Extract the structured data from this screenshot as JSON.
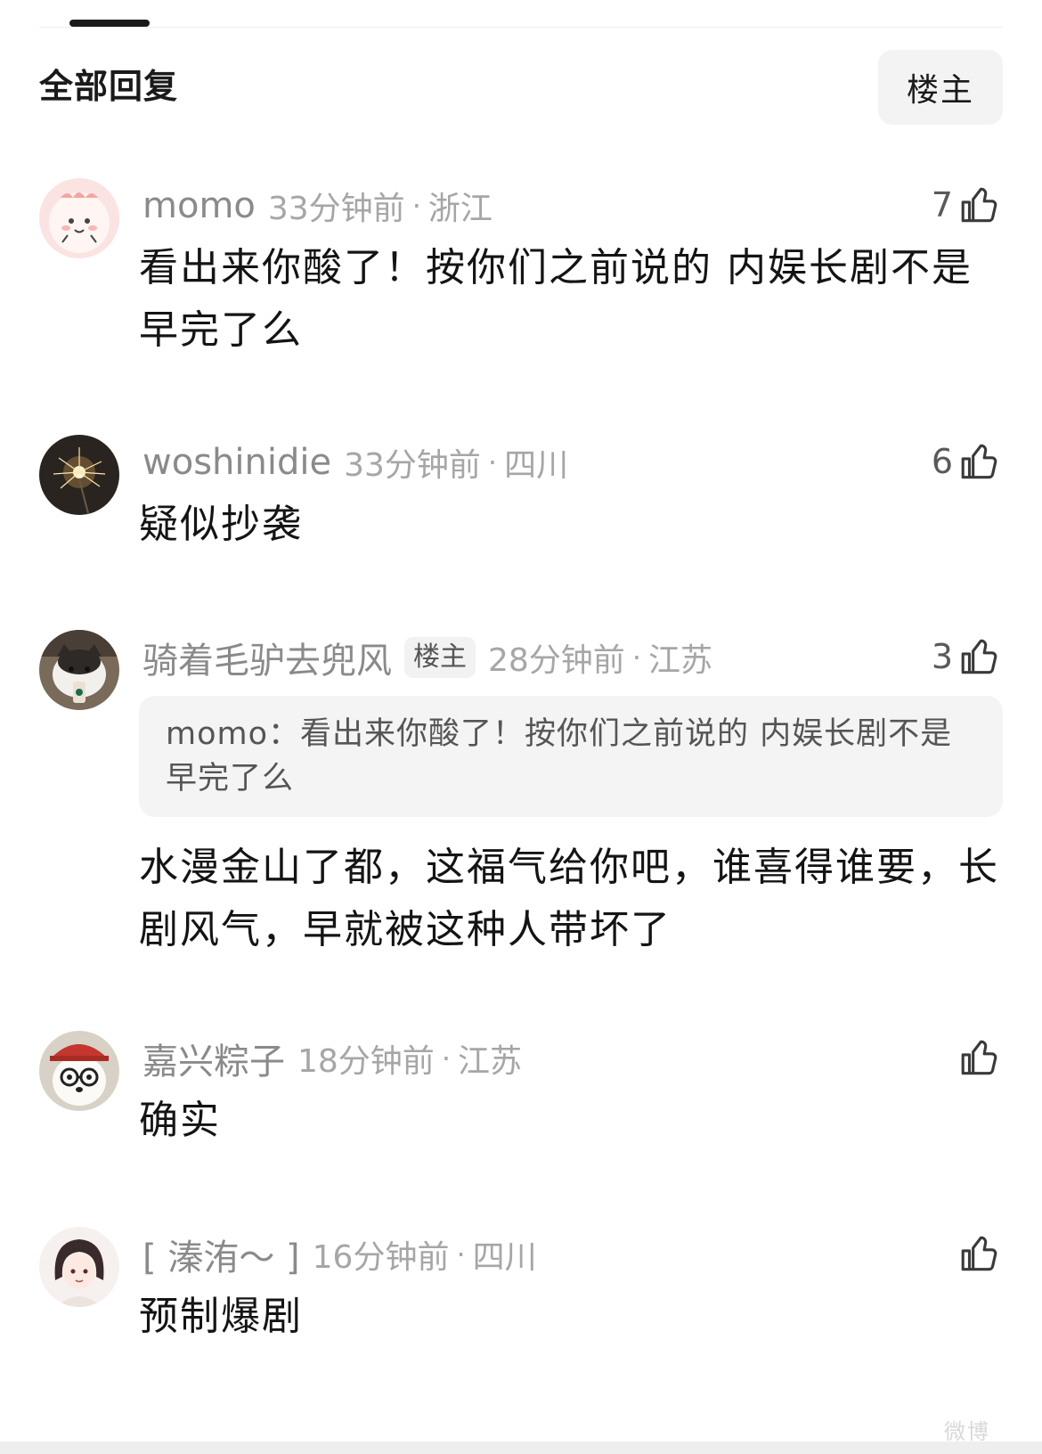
{
  "header": {
    "section_title": "全部回复",
    "filter_label": "楼主"
  },
  "comments": [
    {
      "username": "momo",
      "badge": "",
      "time": "33分钟前",
      "location": "浙江",
      "likes": "7",
      "quote": "",
      "content": "看出来你酸了！按你们之前说的 内娱长剧不是早完了么",
      "avatar_icon": "cartoon-face-avatar"
    },
    {
      "username": "woshinidie",
      "badge": "",
      "time": "33分钟前",
      "location": "四川",
      "likes": "6",
      "quote": "",
      "content": "疑似抄袭",
      "avatar_icon": "sparkler-avatar"
    },
    {
      "username": "骑着毛驴去兜风",
      "badge": "楼主",
      "time": "28分钟前",
      "location": "江苏",
      "likes": "3",
      "quote": "momo：看出来你酸了！按你们之前说的 内娱长剧不是早完了么",
      "content": "水漫金山了都，这福气给你吧，谁喜得谁要，长剧风气，早就被这种人带坏了",
      "avatar_icon": "cat-with-drink-avatar"
    },
    {
      "username": "嘉兴粽子",
      "badge": "",
      "time": "18分钟前",
      "location": "江苏",
      "likes": "",
      "quote": "",
      "content": "确实",
      "avatar_icon": "plush-dog-with-glasses-avatar"
    },
    {
      "username": "[ 溱洧～ ]",
      "badge": "",
      "time": "16分钟前",
      "location": "四川",
      "likes": "",
      "quote": "",
      "content": "预制爆剧",
      "avatar_icon": "anime-girl-avatar"
    }
  ],
  "colors": {
    "text_primary": "#141414",
    "text_secondary": "#8a8a8a",
    "quote_bg": "#f4f4f4"
  },
  "watermark": "微博"
}
